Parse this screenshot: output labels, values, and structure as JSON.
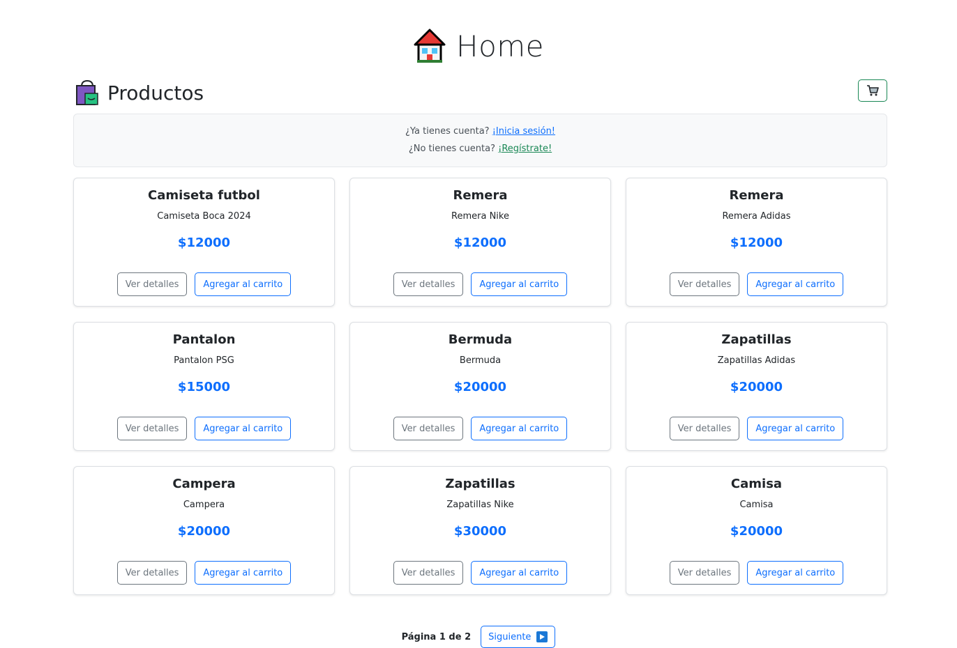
{
  "header": {
    "title": "Home",
    "icon": "house-icon"
  },
  "section": {
    "title": "Productos",
    "icon": "shopping-bag-icon",
    "cart_icon": "cart-icon"
  },
  "auth": {
    "login_prompt": "¿Ya tienes cuenta?",
    "login_link": "¡Inicia sesión!",
    "register_prompt": "¿No tienes cuenta?",
    "register_link": "¡Regístrate!"
  },
  "products": [
    {
      "name": "Camiseta futbol",
      "description": "Camiseta Boca 2024",
      "price": "$12000",
      "details_label": "Ver detalles",
      "add_label": "Agregar al carrito"
    },
    {
      "name": "Remera",
      "description": "Remera Nike",
      "price": "$12000",
      "details_label": "Ver detalles",
      "add_label": "Agregar al carrito"
    },
    {
      "name": "Remera",
      "description": "Remera Adidas",
      "price": "$12000",
      "details_label": "Ver detalles",
      "add_label": "Agregar al carrito"
    },
    {
      "name": "Pantalon",
      "description": "Pantalon PSG",
      "price": "$15000",
      "details_label": "Ver detalles",
      "add_label": "Agregar al carrito"
    },
    {
      "name": "Bermuda",
      "description": "Bermuda",
      "price": "$20000",
      "details_label": "Ver detalles",
      "add_label": "Agregar al carrito"
    },
    {
      "name": "Zapatillas",
      "description": "Zapatillas Adidas",
      "price": "$20000",
      "details_label": "Ver detalles",
      "add_label": "Agregar al carrito"
    },
    {
      "name": "Campera",
      "description": "Campera",
      "price": "$20000",
      "details_label": "Ver detalles",
      "add_label": "Agregar al carrito"
    },
    {
      "name": "Zapatillas",
      "description": "Zapatillas Nike",
      "price": "$30000",
      "details_label": "Ver detalles",
      "add_label": "Agregar al carrito"
    },
    {
      "name": "Camisa",
      "description": "Camisa",
      "price": "$20000",
      "details_label": "Ver detalles",
      "add_label": "Agregar al carrito"
    }
  ],
  "pagination": {
    "page_label": "Página 1 de 2",
    "next_label": "Siguiente",
    "next_icon": "next-arrow-icon"
  },
  "colors": {
    "primary": "#0d6efd",
    "success": "#198754",
    "secondary": "#6c757d"
  }
}
